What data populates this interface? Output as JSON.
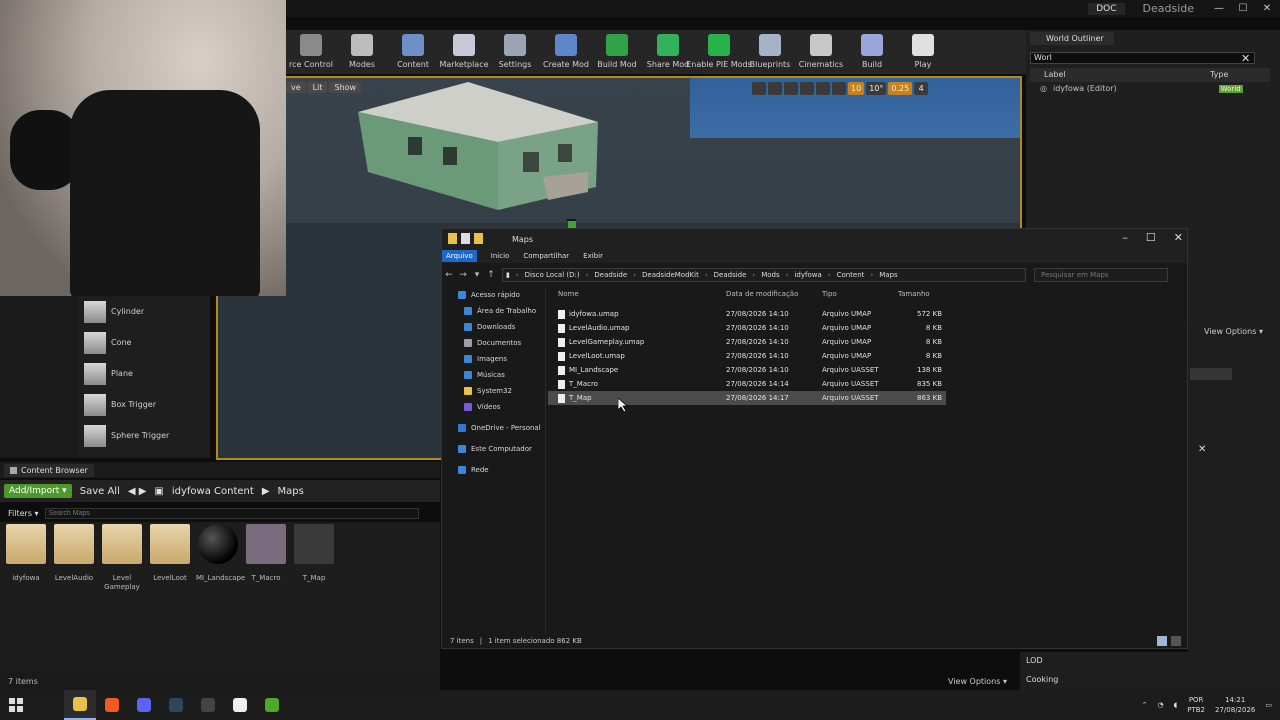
{
  "titlebar": {
    "doc_tab": "DOC",
    "project": "Deadside",
    "min": "—",
    "max": "☐",
    "close": "✕"
  },
  "toolbar": {
    "items": [
      {
        "label": "rce Control",
        "color": "#8a8a8a"
      },
      {
        "label": "Modes",
        "color": "#bdbdbd"
      },
      {
        "label": "Content",
        "color": "#6f8fc9"
      },
      {
        "label": "Marketplace",
        "color": "#c8c8d8"
      },
      {
        "label": "Settings",
        "color": "#9aa4b5"
      },
      {
        "label": "Create Mod",
        "color": "#5e86c9"
      },
      {
        "label": "Build Mod",
        "color": "#2fa24a"
      },
      {
        "label": "Share Mod",
        "color": "#31b15a"
      },
      {
        "label": "Enable PIE Mods",
        "color": "#27b34a"
      },
      {
        "label": "Blueprints",
        "color": "#a4b3c7"
      },
      {
        "label": "Cinematics",
        "color": "#c7c7c7"
      },
      {
        "label": "Build",
        "color": "#9aa6d9"
      },
      {
        "label": "Play",
        "color": "#e0e0e0"
      }
    ]
  },
  "viewport": {
    "chips": [
      "ve",
      "Lit",
      "Show"
    ],
    "right_controls": [
      "10",
      "10°",
      "0.25",
      "4"
    ]
  },
  "place_list": {
    "items": [
      "Cylinder",
      "Cone",
      "Plane",
      "Box Trigger",
      "Sphere Trigger"
    ]
  },
  "content_browser": {
    "tab": "Content Browser",
    "add_import": "Add/Import ▾",
    "save_all": "Save All",
    "path_root": "idyfowa Content",
    "path_leaf": "Maps",
    "filters": "Filters ▾",
    "search_placeholder": "Search Maps",
    "item_count": "7 items",
    "assets": [
      {
        "label": "idyfowa",
        "color": "#c9a86a"
      },
      {
        "label": "LevelAudio",
        "color": "#c9a86a"
      },
      {
        "label": "Level Gameplay",
        "color": "#c9a86a"
      },
      {
        "label": "LevelLoot",
        "color": "#c9a86a"
      },
      {
        "label": "MI_Landscape",
        "color": "#1b1b1b"
      },
      {
        "label": "T_Macro",
        "color": "#7b6b7e"
      },
      {
        "label": "T_Map",
        "color": "#3a3a3a"
      }
    ]
  },
  "world_outliner": {
    "tab": "World Outliner",
    "search_value": "Worl",
    "col_label": "Label",
    "col_type": "Type",
    "row_label": "idyfowa (Editor)",
    "row_type": "World"
  },
  "right_panel": {
    "view_options": "View Options ▾",
    "view_options_bottom": "View Options ▾",
    "lod": "LOD",
    "cooking": "Cooking"
  },
  "explorer": {
    "title": "Maps",
    "ribbon": [
      "Arquivo",
      "Início",
      "Compartilhar",
      "Exibir"
    ],
    "path": [
      "Disco Local (D:)",
      "Deadside",
      "DeadsideModKit",
      "Deadside",
      "Mods",
      "idyfowa",
      "Content",
      "Maps"
    ],
    "search_placeholder": "Pesquisar em Maps",
    "nav": [
      {
        "label": "Acesso rápido",
        "color": "#3a86d9",
        "indent": false
      },
      {
        "label": "Área de Trabalho",
        "color": "#3a86d9",
        "indent": true
      },
      {
        "label": "Downloads",
        "color": "#3a86d9",
        "indent": true
      },
      {
        "label": "Documentos",
        "color": "#9aa0aa",
        "indent": true
      },
      {
        "label": "Imagens",
        "color": "#3a86d9",
        "indent": true
      },
      {
        "label": "Músicas",
        "color": "#3a86d9",
        "indent": true
      },
      {
        "label": "System32",
        "color": "#e7c24a",
        "indent": true
      },
      {
        "label": "Vídeos",
        "color": "#7a5ad9",
        "indent": true
      },
      {
        "label": "OneDrive - Personal",
        "color": "#2f7ad6",
        "indent": false
      },
      {
        "label": "Este Computador",
        "color": "#3a86d9",
        "indent": false
      },
      {
        "label": "Rede",
        "color": "#3a86d9",
        "indent": false
      }
    ],
    "columns": {
      "name": "Nome",
      "date": "Data de modificação",
      "type": "Tipo",
      "size": "Tamanho"
    },
    "files": [
      {
        "name": "idyfowa.umap",
        "date": "27/08/2026 14:10",
        "type": "Arquivo UMAP",
        "size": "572 KB"
      },
      {
        "name": "LevelAudio.umap",
        "date": "27/08/2026 14:10",
        "type": "Arquivo UMAP",
        "size": "8 KB"
      },
      {
        "name": "LevelGameplay.umap",
        "date": "27/08/2026 14:10",
        "type": "Arquivo UMAP",
        "size": "8 KB"
      },
      {
        "name": "LevelLoot.umap",
        "date": "27/08/2026 14:10",
        "type": "Arquivo UMAP",
        "size": "8 KB"
      },
      {
        "name": "MI_Landscape",
        "date": "27/08/2026 14:10",
        "type": "Arquivo UASSET",
        "size": "138 KB"
      },
      {
        "name": "T_Macro",
        "date": "27/08/2026 14:14",
        "type": "Arquivo UASSET",
        "size": "835 KB"
      },
      {
        "name": "T_Map",
        "date": "27/08/2026 14:17",
        "type": "Arquivo UASSET",
        "size": "863 KB"
      }
    ],
    "status_count": "7 itens",
    "status_selected": "1 item selecionado  862 KB"
  },
  "taskbar": {
    "apps": [
      {
        "name": "explorer",
        "color": "#e7c24a"
      },
      {
        "name": "brave",
        "color": "#f15a24"
      },
      {
        "name": "discord",
        "color": "#5865f2"
      },
      {
        "name": "steam",
        "color": "#2a475e"
      },
      {
        "name": "terminal",
        "color": "#444"
      },
      {
        "name": "unreal",
        "color": "#eeeeee"
      },
      {
        "name": "epic",
        "color": "#4ea82a"
      }
    ],
    "lang": "POR",
    "layout": "PTB2",
    "time": "14:21",
    "date": "27/08/2026"
  }
}
